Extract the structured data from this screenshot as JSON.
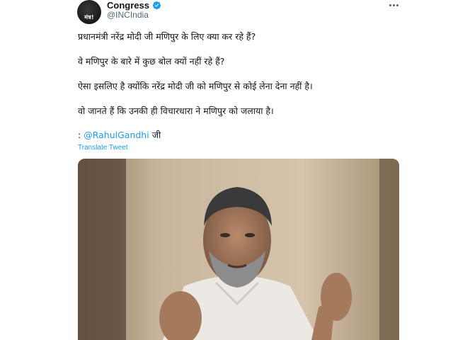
{
  "account": {
    "display_name": "Congress",
    "handle": "@INCIndia",
    "avatar_text": "मंत्र!",
    "verified_color": "#1d9bf0"
  },
  "tweet": {
    "lines": [
      "प्रधानमंत्री नरेंद्र मोदी जी मणिपुर के लिए क्या कर रहे हैं?",
      "वे मणिपुर के बारे में कुछ बोल क्यों नहीं रहे हैं?",
      "ऐसा इसलिए है क्योंकि नरेंद्र मोदी जी को मणिपुर से कोई लेना देना नहीं है।",
      "वो जानते हैं कि उनकी ही विचारधारा ने मणिपुर को जलाया है।"
    ],
    "mention_prefix": ":",
    "mention": "@RahulGandhi",
    "mention_suffix": "जी",
    "translate_label": "Translate Tweet"
  },
  "icons": {
    "verified": "verified-badge-icon",
    "more": "more-options-icon"
  },
  "colors": {
    "link": "#1d9bf0",
    "text": "#0f1419",
    "secondary": "#536471"
  }
}
